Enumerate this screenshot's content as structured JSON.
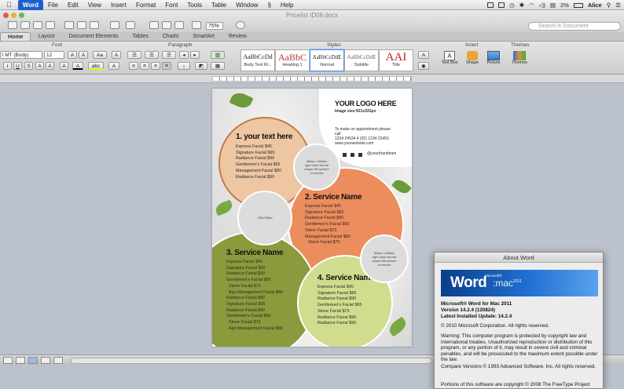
{
  "menubar": {
    "apple": "",
    "app": "Word",
    "items": [
      "File",
      "Edit",
      "View",
      "Insert",
      "Format",
      "Font",
      "Tools",
      "Table",
      "Window",
      "Help"
    ],
    "status": {
      "battery": "2%",
      "user": "Alice"
    }
  },
  "toolbar": {
    "doc_title": "Pricelist ID09.docx",
    "zoom": "75%",
    "search_placeholder": "Search in Document"
  },
  "tabs": [
    "Home",
    "Layout",
    "Document Elements",
    "Tables",
    "Charts",
    "SmartArt",
    "Review"
  ],
  "ribbon": {
    "groups": {
      "font": "Font",
      "paragraph": "Paragraph",
      "styles": "Styles",
      "insert": "Insert",
      "themes": "Themes"
    },
    "font_name": "l MT (Body)",
    "font_size": "12",
    "styles": [
      {
        "preview": "AaBbCcDd",
        "name": "Body Text Ri..."
      },
      {
        "preview": "AaBbC",
        "name": "Heading 1"
      },
      {
        "preview": "AaBbCcDdE",
        "name": "Normal"
      },
      {
        "preview": "AaBbCcDdE",
        "name": "Subtitle"
      },
      {
        "preview": "AAI",
        "name": "Title"
      }
    ],
    "insert": {
      "text_box": "Text Box",
      "shape": "Shape",
      "picture": "Picture"
    },
    "themes_btn": "Themes"
  },
  "flyer": {
    "logo_title": "YOUR LOGO HERE",
    "logo_size": "Image size:921x331px",
    "appointment": [
      "To make on appointment please",
      "call",
      "1234 24534 4 (02) 1234 23453",
      "www.yourwebsite.com"
    ],
    "social": "@yourbrandnam",
    "ph_small": [
      "866px x 866px",
      "right click>format",
      "shape>fill>picture",
      "or texture"
    ],
    "ph_mid": "788x788px",
    "ph_right": [
      "866px x 866px",
      "right click>format",
      "shape>fill>picture",
      "or texture"
    ],
    "sections": [
      {
        "title": "1. your text here",
        "items": [
          "Express Facial $45",
          "Signature Facial $65",
          "Radiance Facial $90",
          "Gentlemen's Facial $65",
          "Management Facial $80",
          "Radiance Facial $90"
        ]
      },
      {
        "title": "2. Service Name",
        "items": [
          "Express Facial $45",
          "Signature Facial $65",
          "Radiance Facial $90",
          "Gentlemen's Facial $65",
          "Stone Facial $75",
          "Management Facial $80",
          "Stone Facial $75"
        ]
      },
      {
        "title": "3. Service Name",
        "items": [
          "Express Facial $45",
          "Signature Facial $65",
          "Radiance Facial $90",
          "Gentlemen's Facial $65",
          "Stone Facial $73",
          "Age Management Facial $80",
          "Radiance Facial $90",
          "Signature Facial $65",
          "Radiance Facial $90",
          "Gentlemen's Facial $65",
          "Stone Facial $73",
          "Age Management Facial $80"
        ]
      },
      {
        "title": "4. Service Name",
        "items": [
          "Express Facial $45",
          "Signature Facial $65",
          "Radiance Facial $90",
          "Gentlemen's Facial $65",
          "Stone Facial $73",
          "Radiance Facial $90",
          "Radiance Facial $90"
        ]
      }
    ]
  },
  "about": {
    "title": "About Word",
    "banner_logo": "Word",
    "banner_mac": ":mac",
    "banner_year": "2011",
    "banner_ms": "Microsoft®",
    "product": "Microsoft® Word for Mac 2011",
    "version": "Version 14.2.4 (120824)",
    "update": "Latest Installed Update: 14.2.4",
    "copyright": "© 2010 Microsoft Corporation. All rights reserved.",
    "warning": "Warning: This computer program is protected by copyright law and international treaties. Unauthorized reproduction or distribution of this program, or any portion of it, may result in severe civil and criminal penalties, and will be prosecuted to the maximum extent possible under the law.",
    "compare": "Compare Versions © 1993 Advanced Software, Inc. All rights reserved.",
    "freetype": "Portions of this software are copyright © 2008 The FreeType Project"
  },
  "colors": {
    "peach": "#eec6a2",
    "orange": "#ec8d5e",
    "olive": "#8b9a3c",
    "lightgreen": "#d2dc8e",
    "circle_gray": "#dcdcdc",
    "word_blue": "#1b5fcc"
  }
}
